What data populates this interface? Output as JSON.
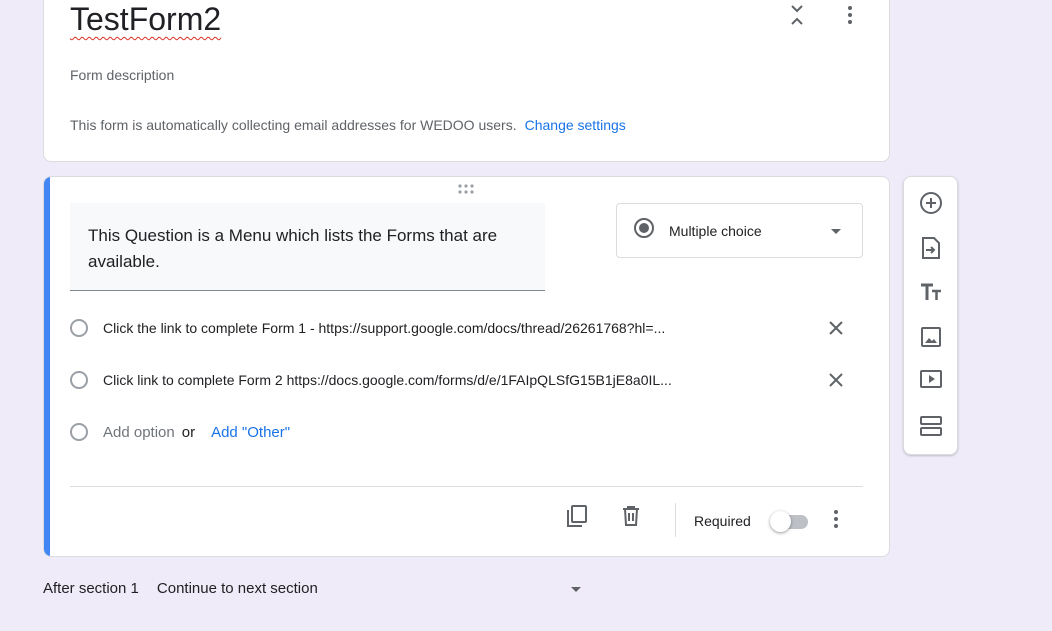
{
  "title_card": {
    "title": "TestForm2",
    "description_placeholder": "Form description",
    "email_note": "This form is automatically collecting email addresses for WEDOO users.",
    "change_settings": "Change settings"
  },
  "question": {
    "text": "This Question is a Menu which lists the  Forms that are available.",
    "type": "Multiple choice",
    "options": [
      "Click the link to complete Form 1 - https://support.google.com/docs/thread/26261768?hl=...",
      "Click link to complete Form 2 https://docs.google.com/forms/d/e/1FAIpQLSfG15B1jE8a0IL..."
    ],
    "add_option": "Add option",
    "or": "or",
    "add_other": "Add \"Other\"",
    "required_label": "Required",
    "required": false
  },
  "section_nav": {
    "label": "After section 1",
    "value": "Continue to next section"
  },
  "icons": {
    "toolbar": [
      "add-question-icon",
      "import-questions-icon",
      "add-title-icon",
      "add-image-icon",
      "add-video-icon",
      "add-section-icon"
    ],
    "footer": [
      "duplicate-icon",
      "delete-icon",
      "more-vert-icon"
    ]
  },
  "colors": {
    "background": "#f0ebf8",
    "accent": "#4285f4",
    "link": "#1a73e8"
  }
}
